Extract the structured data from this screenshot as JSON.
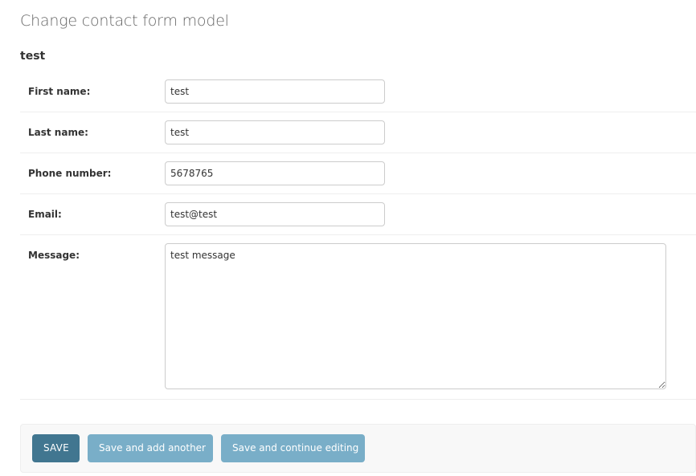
{
  "page": {
    "title": "Change contact form model",
    "object_name": "test"
  },
  "form": {
    "fields": {
      "first_name": {
        "label": "First name:",
        "value": "test"
      },
      "last_name": {
        "label": "Last name:",
        "value": "test"
      },
      "phone_number": {
        "label": "Phone number:",
        "value": "5678765"
      },
      "email": {
        "label": "Email:",
        "value": "test@test"
      },
      "message": {
        "label": "Message:",
        "value": "test message"
      }
    }
  },
  "submit_row": {
    "save_label": "SAVE",
    "save_add_another_label": "Save and add another",
    "save_continue_label": "Save and continue editing"
  },
  "colors": {
    "primary_button": "#417690",
    "secondary_button": "#79aec8"
  }
}
